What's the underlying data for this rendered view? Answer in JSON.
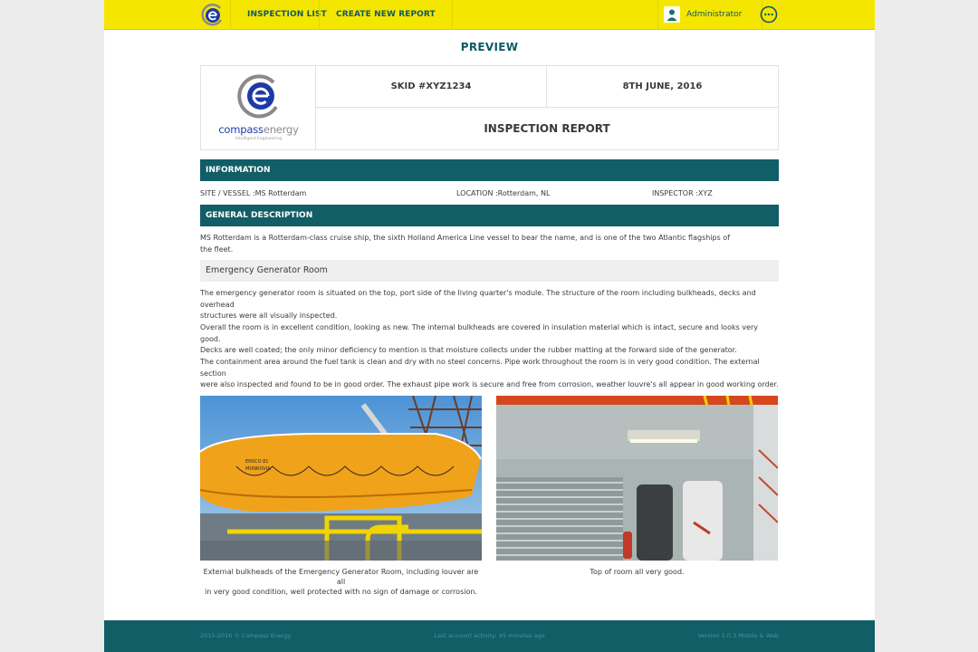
{
  "nav": {
    "inspection_list": "INSPECTION LIST",
    "create_new_report": "CREATE NEW REPORT",
    "user": "Administrator"
  },
  "preview_title": "PREVIEW",
  "report": {
    "brand_part1": "compass",
    "brand_part2": "energy",
    "brand_tagline": "Intelligent Engineering",
    "skid": "SKID #XYZ1234",
    "date": "8TH JUNE, 2016",
    "title": "INSPECTION REPORT"
  },
  "information": {
    "heading": "INFORMATION",
    "site": "SITE / VESSEL :MS Rotterdam",
    "location": "LOCATION :Rotterdam, NL",
    "inspector": "INSPECTOR :XYZ"
  },
  "general": {
    "heading": "GENERAL DESCRIPTION",
    "line1": "MS Rotterdam is a Rotterdam-class cruise ship, the sixth Holland America Line vessel to bear the name, and is one of the two Atlantic flagships of",
    "line2": "the fleet."
  },
  "room": {
    "title": "Emergency Generator Room",
    "p1a": "The emergency generator room is situated on the top, port side of the living quarter's module. The structure of the room including bulkheads, decks and overhead",
    "p1b": "structures were all visually inspected.",
    "p2a": "Overall the room is in excellent condition, looking as new. The internal bulkheads are covered in insulation material which is intact, secure and looks very good.",
    "p2b": "Decks are well coated; the only minor deficiency to mention is that moisture collects under the rubber matting at the forward side of the generator.",
    "p3a": "The containment area around the fuel tank is clean and dry with no steel concerns. Pipe work throughout the room is in very good condition. The external section",
    "p3b": "were also inspected and found to be in good order. The exhaust pipe work is secure and free from corrosion, weather louvre's all appear in good working order."
  },
  "photos": {
    "lifeboat_text1": "ENSCO 81",
    "lifeboat_text2": "MONROVIA",
    "caption1a": "External bulkheads of the Emergency Generator Room, including louver are all",
    "caption1b": "in very good condition, well protected with no sign of damage or corrosion.",
    "caption2": "Top of room all very good."
  },
  "footer": {
    "copyright": "2015-2016 © Compass Energy",
    "activity": "Last account activity: 45 minutes ago",
    "version": "Version 1.0.3 Mobile & Web"
  },
  "colors": {
    "topbar": "#f5e600",
    "teal": "#115e66",
    "brand_blue": "#1d3aa6"
  }
}
